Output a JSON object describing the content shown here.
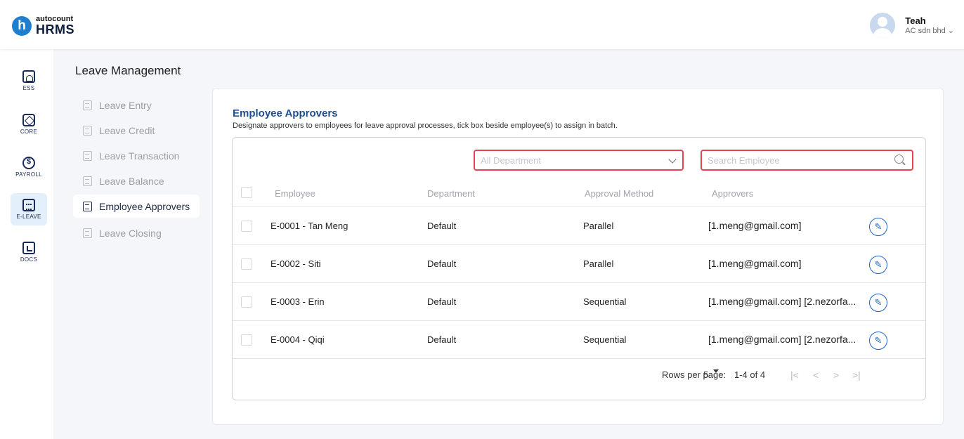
{
  "header": {
    "logo_small": "autocount",
    "logo_big": "HRMS",
    "logo_mark": "h",
    "user_name": "Teah",
    "user_company": "AC sdn bhd"
  },
  "rail": [
    {
      "label": "ESS",
      "icon": "ess-icon",
      "active": false
    },
    {
      "label": "CORE",
      "icon": "core-icon",
      "active": false
    },
    {
      "label": "PAYROLL",
      "icon": "payroll-icon",
      "active": false
    },
    {
      "label": "E-LEAVE",
      "icon": "calendar-icon",
      "active": true
    },
    {
      "label": "DOCS",
      "icon": "docs-icon",
      "active": false
    }
  ],
  "module_title": "Leave Management",
  "subnav": [
    {
      "label": "Leave Entry",
      "active": false
    },
    {
      "label": "Leave Credit",
      "active": false
    },
    {
      "label": "Leave Transaction",
      "active": false
    },
    {
      "label": "Leave Balance",
      "active": false
    },
    {
      "label": "Employee Approvers",
      "active": true
    },
    {
      "label": "Leave Closing",
      "active": false
    }
  ],
  "card": {
    "title": "Employee Approvers",
    "description": "Designate approvers to employees for leave approval processes, tick box beside employee(s) to assign in batch."
  },
  "filters": {
    "department_value": "All Department",
    "search_placeholder": "Search Employee"
  },
  "table": {
    "columns": [
      "Employee",
      "Department",
      "Approval Method",
      "Approvers"
    ],
    "rows": [
      {
        "employee": "E-0001 - Tan Meng",
        "department": "Default",
        "method": "Parallel",
        "approvers": "[1.meng@gmail.com]"
      },
      {
        "employee": "E-0002 - Siti",
        "department": "Default",
        "method": "Parallel",
        "approvers": "[1.meng@gmail.com]"
      },
      {
        "employee": "E-0003 - Erin",
        "department": "Default",
        "method": "Sequential",
        "approvers": "[1.meng@gmail.com] [2.nezorfa..."
      },
      {
        "employee": "E-0004 - Qiqi",
        "department": "Default",
        "method": "Sequential",
        "approvers": "[1.meng@gmail.com] [2.nezorfa..."
      }
    ]
  },
  "pagination": {
    "rows_per_page_label": "Rows per page:",
    "rows_per_page": "5",
    "range": "1-4 of 4",
    "first": "|<",
    "prev": "<",
    "next": ">",
    "last": ">|"
  },
  "colors": {
    "accent": "#1d4f91",
    "highlight_border": "#e0444e",
    "edit_button": "#1e64c8"
  }
}
